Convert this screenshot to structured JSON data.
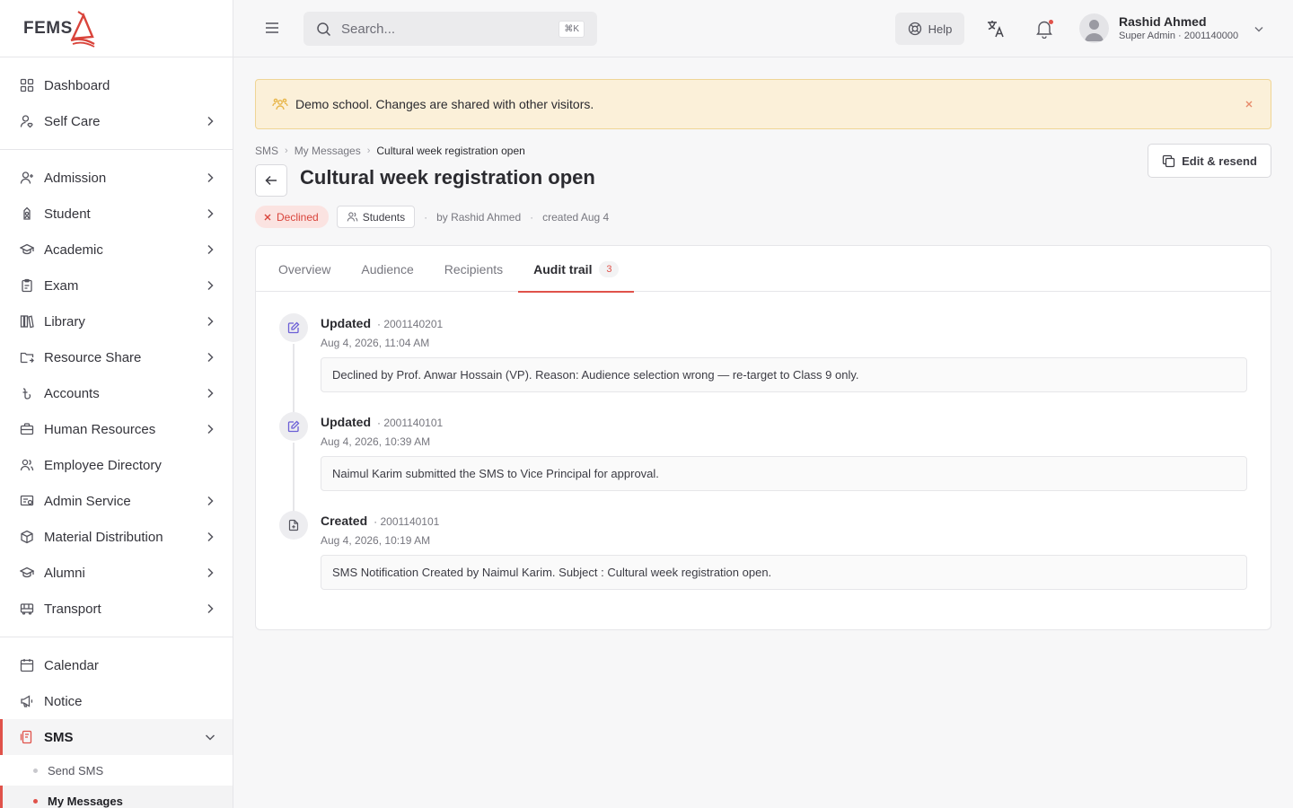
{
  "brand": {
    "logo_text": "FEMS"
  },
  "sidebar": {
    "groups": [
      [
        {
          "label": "Dashboard",
          "icon": "grid-icon",
          "chevron": false
        },
        {
          "label": "Self Care",
          "icon": "user-heart-icon",
          "chevron": true
        }
      ],
      [
        {
          "label": "Admission",
          "icon": "user-plus-icon",
          "chevron": true
        },
        {
          "label": "Student",
          "icon": "student-icon",
          "chevron": true
        },
        {
          "label": "Academic",
          "icon": "graduation-cap-icon",
          "chevron": true
        },
        {
          "label": "Exam",
          "icon": "clipboard-icon",
          "chevron": true
        },
        {
          "label": "Library",
          "icon": "library-icon",
          "chevron": true
        },
        {
          "label": "Resource Share",
          "icon": "folder-share-icon",
          "chevron": true
        },
        {
          "label": "Accounts",
          "icon": "taka-icon",
          "chevron": true
        },
        {
          "label": "Human Resources",
          "icon": "briefcase-icon",
          "chevron": true
        },
        {
          "label": "Employee Directory",
          "icon": "users-icon",
          "chevron": false
        },
        {
          "label": "Admin Service",
          "icon": "admin-service-icon",
          "chevron": true
        },
        {
          "label": "Material Distribution",
          "icon": "box-icon",
          "chevron": true
        },
        {
          "label": "Alumni",
          "icon": "graduation-cap-icon",
          "chevron": true
        },
        {
          "label": "Transport",
          "icon": "bus-icon",
          "chevron": true
        }
      ],
      [
        {
          "label": "Calendar",
          "icon": "calendar-icon",
          "chevron": false
        },
        {
          "label": "Notice",
          "icon": "megaphone-icon",
          "chevron": false
        },
        {
          "label": "SMS",
          "icon": "sms-icon",
          "chevron": true,
          "expanded": true,
          "active": true
        }
      ]
    ],
    "sms_children": [
      {
        "label": "Send SMS",
        "active": false
      },
      {
        "label": "My Messages",
        "active": true
      }
    ]
  },
  "topbar": {
    "search_placeholder": "Search...",
    "search_shortcut": "⌘K",
    "help_label": "Help",
    "user_name": "Rashid Ahmed",
    "user_role": "Super Admin · 2001140000"
  },
  "banner": {
    "text": "Demo school. Changes are shared with other visitors."
  },
  "breadcrumb": [
    "SMS",
    "My Messages",
    "Cultural week registration open"
  ],
  "page": {
    "title": "Cultural week registration open",
    "edit_label": "Edit & resend",
    "status": "Declined",
    "audience": "Students",
    "by": "by Rashid Ahmed",
    "created": "created Aug 4"
  },
  "tabs": [
    {
      "label": "Overview",
      "active": false
    },
    {
      "label": "Audience",
      "active": false
    },
    {
      "label": "Recipients",
      "active": false
    },
    {
      "label": "Audit trail",
      "active": true,
      "count": "3"
    }
  ],
  "audit_trail": [
    {
      "action": "Updated",
      "actor": "· 2001140201",
      "time": "Aug 4, 2026, 11:04 AM",
      "message": "Declined by Prof. Anwar Hossain (VP). Reason: Audience selection wrong — re-target to Class 9 only.",
      "icon": "edit-icon"
    },
    {
      "action": "Updated",
      "actor": "· 2001140101",
      "time": "Aug 4, 2026, 10:39 AM",
      "message": "Naimul Karim submitted the SMS to Vice Principal for approval.",
      "icon": "edit-icon"
    },
    {
      "action": "Created",
      "actor": "· 2001140101",
      "time": "Aug 4, 2026, 10:19 AM",
      "message": "SMS Notification Created by Naimul Karim. Subject : Cultural week registration open.",
      "icon": "file-plus-icon"
    }
  ],
  "colors": {
    "accent": "#e0524a",
    "banner_bg": "#fbf0d9",
    "edit_icon": "#6b5fd6"
  }
}
